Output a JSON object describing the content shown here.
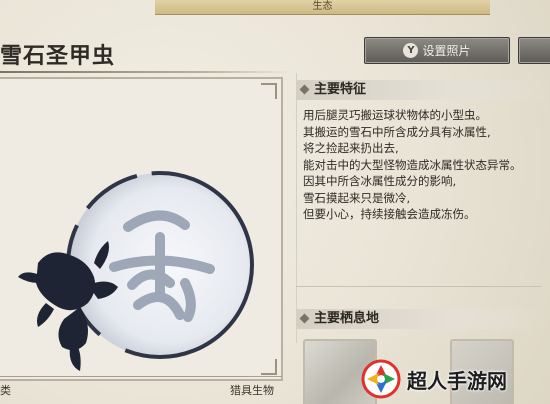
{
  "top_tab": {
    "label": "生态"
  },
  "header": {
    "title": "雪石圣甲虫",
    "photo_button": {
      "key": "Y",
      "label": "设置照片"
    }
  },
  "features": {
    "heading": "主要特征",
    "lines": [
      "用后腿灵巧搬运球状物体的小型虫。",
      "其搬运的雪石中所含成分具有冰属性,",
      "将之捡起来扔出去,",
      "能对击中的大型怪物造成冰属性状态异常。",
      "因其中所含冰属性成分的影响,",
      "雪石摸起来只是微冷,",
      "但要小心，持续接触会造成冻伤。"
    ]
  },
  "habitat": {
    "heading": "主要栖息地"
  },
  "footer": {
    "left": "类",
    "right": "猎具生物"
  },
  "watermark": {
    "text": "超人手游网"
  },
  "colors": {
    "accent": "#c8b27a",
    "button": "#6f6c67",
    "logo_red": "#e0312b"
  }
}
